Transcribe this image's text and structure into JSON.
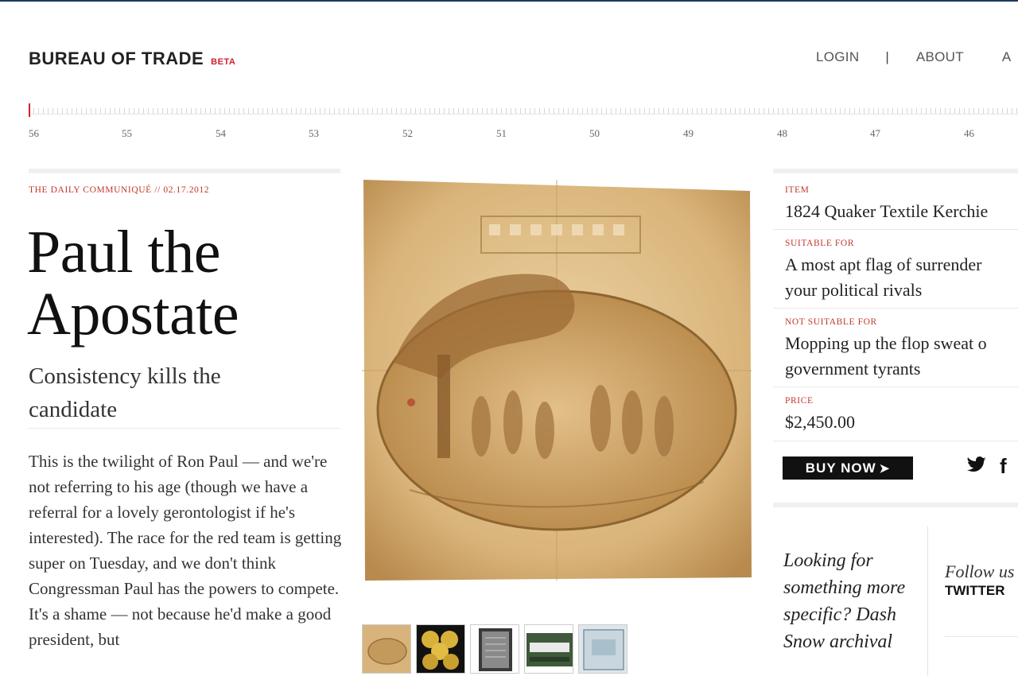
{
  "header": {
    "logo": "BUREAU OF TRADE",
    "badge": "BETA",
    "nav": [
      {
        "label": "LOGIN"
      },
      {
        "label": "|"
      },
      {
        "label": "ABOUT"
      },
      {
        "label": "A"
      }
    ]
  },
  "timeline": {
    "labels": [
      "56",
      "55",
      "54",
      "53",
      "52",
      "51",
      "50",
      "49",
      "48",
      "47",
      "46"
    ],
    "marker_color": "#d0202b"
  },
  "article": {
    "kicker": "THE DAILY COMMUNIQUÉ",
    "kicker_sep": "//",
    "date": "02.17.2012",
    "headline_line1": "Paul the",
    "headline_line2": "Apostate",
    "subhead": "Consistency kills the candidate",
    "body": "This is the twilight of Ron Paul — and we're not referring to his age (though we have a referral for a lovely gerontologist if he's interested). The race for the red team is getting super on Tuesday, and we don't think Congressman Paul has the powers to compete. It's a shame — not because he'd make a good president, but"
  },
  "gallery": {
    "main_image": "antique-quaker-textile-kerchief",
    "thumbnails": [
      "kerchief-thumb",
      "gold-coins-thumb",
      "framed-document-thumb",
      "green-case-thumb",
      "blue-certificate-thumb"
    ]
  },
  "product": {
    "item_label": "ITEM",
    "item_value": "1824 Quaker Textile Kerchie",
    "suitable_label": "SUITABLE FOR",
    "suitable_line1": "A most apt flag of surrender",
    "suitable_line2": "your political rivals",
    "not_suitable_label": "NOT SUITABLE FOR",
    "not_suitable_line1": "Mopping up the flop sweat o",
    "not_suitable_line2": "government tyrants",
    "price_label": "PRICE",
    "price_value": "$2,450.00",
    "buy_label": "BUY NOW",
    "share_icons": [
      "twitter-icon",
      "facebook-icon"
    ]
  },
  "promo": {
    "text": "Looking for something more specific? Dash Snow archival"
  },
  "follow": {
    "line": "Follow us",
    "link": "TWITTER"
  },
  "colors": {
    "accent": "#d0202b",
    "label_red": "#c0392b",
    "button_bg": "#111111"
  }
}
